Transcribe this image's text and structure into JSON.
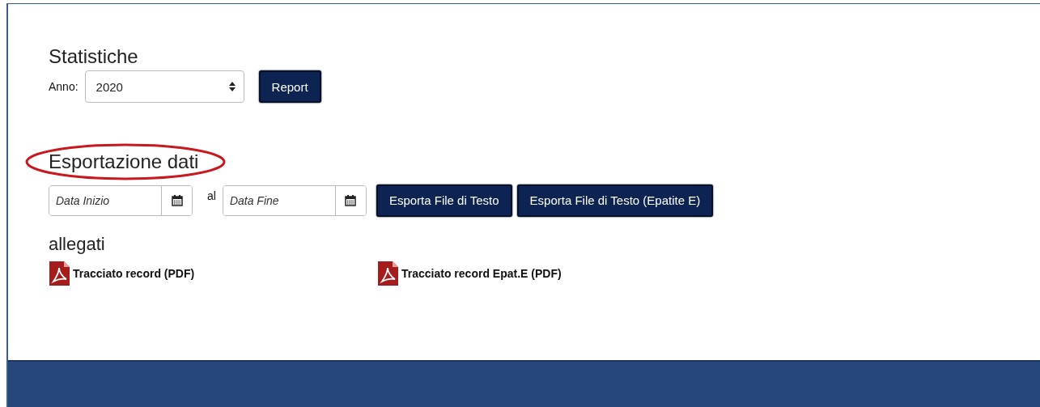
{
  "statistics": {
    "title": "Statistiche",
    "year_label": "Anno:",
    "year": "2020",
    "button": "Report"
  },
  "export": {
    "title": "Esportazione dati",
    "highlighted": true,
    "start": {
      "placeholder": "Data Inizio"
    },
    "separator": "al",
    "end": {
      "placeholder": "Data Fine"
    },
    "buttons": [
      "Esporta File di Testo",
      "Esporta File di Testo (Epatite E)"
    ]
  },
  "attachments": {
    "title": "allegati",
    "links": [
      {
        "label": "Tracciato record (PDF)"
      },
      {
        "label": "Tracciato record Epat.E (PDF)"
      }
    ]
  }
}
